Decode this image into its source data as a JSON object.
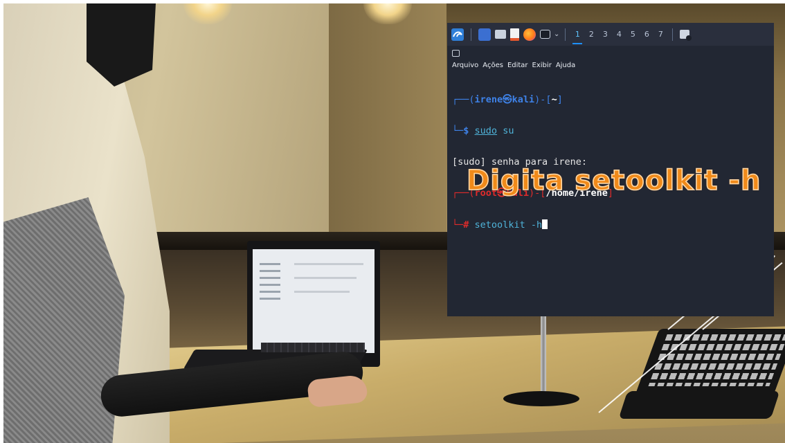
{
  "terminal": {
    "taskbar": {
      "icons": [
        "kali-menu-icon",
        "desktop-icon",
        "file-manager-icon",
        "text-editor-icon",
        "firefox-icon",
        "terminal-icon"
      ],
      "workspaces": [
        "1",
        "2",
        "3",
        "4",
        "5",
        "6",
        "7"
      ],
      "active_workspace": "1"
    },
    "menu": {
      "arquivo": "Arquivo",
      "acoes": "Ações",
      "editar": "Editar",
      "exibir": "Exibir",
      "ajuda": "Ajuda"
    },
    "session": {
      "user": "irene",
      "host": "kali",
      "at_symbol": "㉿",
      "home_dir": "~",
      "prompt_symbol": "$",
      "command1_sudo": "sudo",
      "command1_rest": " su",
      "sudo_prompt": "[sudo] senha para irene:",
      "root_user": "root",
      "root_dir": "/home/irene",
      "root_prompt_symbol": "#",
      "command2": "setoolkit -h"
    },
    "caption": "Digita setoolkit -h"
  },
  "colors": {
    "terminal_bg": "#222733",
    "prompt_blue": "#3e82e8",
    "root_red": "#e02b2b",
    "command_cyan": "#4fb3d9",
    "caption_orange": "#f08a1a"
  }
}
